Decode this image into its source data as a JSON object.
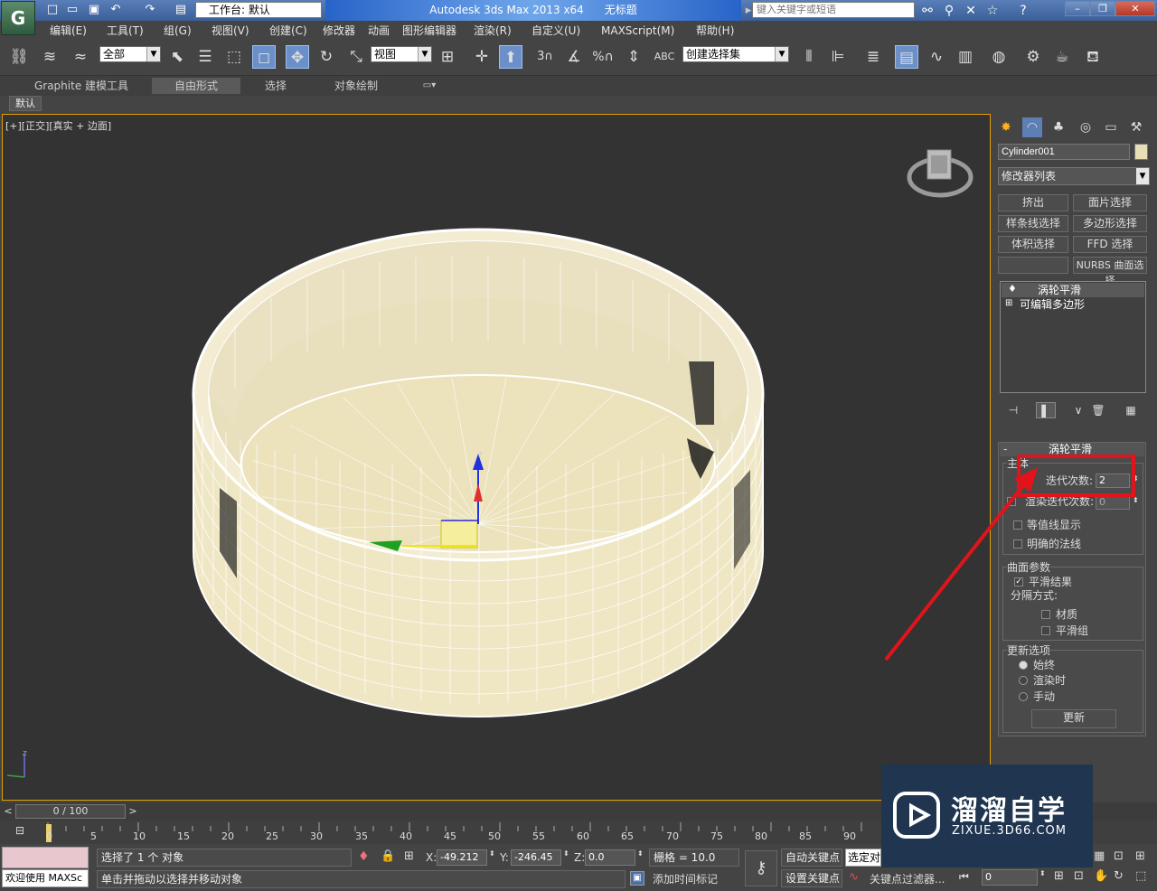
{
  "titlebar": {
    "workspace_label": "工作台: 默认",
    "app_title": "Autodesk 3ds Max  2013 x64",
    "doc_title": "无标题",
    "search_placeholder": "键入关键字或短语"
  },
  "menubar": {
    "items": [
      "编辑(E)",
      "工具(T)",
      "组(G)",
      "视图(V)",
      "创建(C)",
      "修改器",
      "动画",
      "图形编辑器",
      "渲染(R)",
      "自定义(U)",
      "MAXScript(M)",
      "帮助(H)"
    ]
  },
  "toolbar": {
    "selection_filter": "全部",
    "reference_coord": "视图",
    "named_selection": "创建选择集",
    "snap_label": "3",
    "percent_label": "%"
  },
  "ribbon": {
    "tabs": [
      "Graphite 建模工具",
      "自由形式",
      "选择",
      "对象绘制"
    ],
    "subtab": "默认"
  },
  "viewport": {
    "label": "[+][正交][真实 + 边面]",
    "axis_z": "z"
  },
  "command_panel": {
    "object_name": "Cylinder001",
    "object_color": "#e9dfb5",
    "modifier_list": "修改器列表",
    "modifier_buttons": [
      "挤出",
      "面片选择",
      "样条线选择",
      "多边形选择",
      "体积选择",
      "FFD 选择",
      "",
      "NURBS 曲面选择"
    ],
    "stack": [
      "涡轮平滑",
      "可编辑多边形"
    ]
  },
  "turbosmooth": {
    "title": "涡轮平滑",
    "main_group": "主体",
    "iterations_label": "迭代次数:",
    "iterations_value": "2",
    "render_iters_label": "渲染迭代次数:",
    "render_iters_value": "0",
    "isoline": "等值线显示",
    "explicit_normals": "明确的法线",
    "surface_group": "曲面参数",
    "smooth_result": "平滑结果",
    "separate_by": "分隔方式:",
    "materials": "材质",
    "smoothing_groups": "平滑组",
    "update_group": "更新选项",
    "always": "始终",
    "when_rendering": "渲染时",
    "manually": "手动",
    "update_button": "更新"
  },
  "timeline": {
    "frame_display": "0 / 100",
    "ticks": [
      "0",
      "5",
      "10",
      "15",
      "20",
      "25",
      "30",
      "35",
      "40",
      "45",
      "50",
      "55",
      "60",
      "65",
      "70",
      "75",
      "80",
      "85",
      "90"
    ]
  },
  "statusbar": {
    "selected_text": "选择了 1 个 对象",
    "prompt_text": "单击并拖动以选择并移动对象",
    "maxscript_label": "欢迎使用 MAXSc",
    "x_label": "X:",
    "x_value": "-49.212",
    "y_label": "Y:",
    "y_value": "-246.45",
    "z_label": "Z:",
    "z_value": "0.0",
    "grid_text": "栅格 = 10.0",
    "add_time_tag": "添加时间标记",
    "auto_key": "自动关键点",
    "selected_dropdown": "选定对",
    "set_key": "设置关键点",
    "key_filters": "关键点过滤器...",
    "frame_field": "0"
  },
  "watermark": {
    "brand": "溜溜自学",
    "url": "ZIXUE.3D66.COM"
  },
  "colors": {
    "annotation_red": "#e0141a",
    "viewport_border": "#e0a000",
    "mesh_fill": "#efe6c4"
  }
}
